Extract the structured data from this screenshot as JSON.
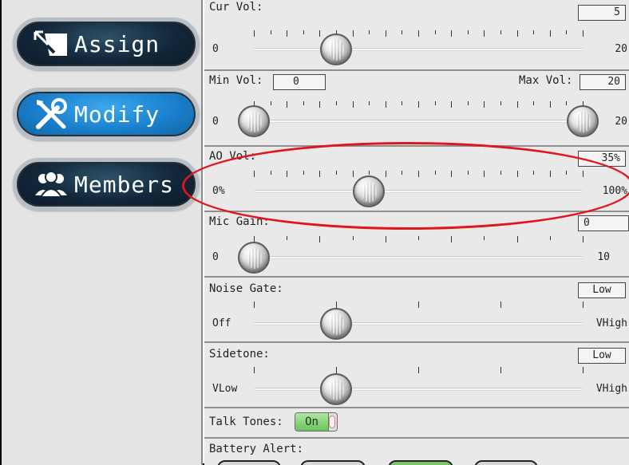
{
  "sidebar": {
    "buttons": [
      {
        "label": "Assign",
        "icon": "assign-arrow-icon",
        "style": "dark"
      },
      {
        "label": "Modify",
        "icon": "wrench-screwdriver-icon",
        "style": "blue"
      },
      {
        "label": "Members",
        "icon": "people-group-icon",
        "style": "dark"
      }
    ]
  },
  "settings": {
    "cur_vol": {
      "label": "Cur Vol:",
      "value": "5",
      "min_label": "0",
      "max_label": "20",
      "min": 0,
      "max": 20,
      "position": 5
    },
    "min_max_vol": {
      "min_label_text": "Min Vol:",
      "min_value": "0",
      "max_label_text": "Max Vol:",
      "max_value": "20",
      "range_min_label": "0",
      "range_max_label": "20",
      "low": 0,
      "high": 20
    },
    "ao_vol": {
      "label": "AO Vol:",
      "value": "35%",
      "min_label": "0%",
      "max_label": "100%",
      "position_percent": 35
    },
    "mic_gain": {
      "label": "Mic Gain:",
      "value": "0",
      "min_label": "0",
      "max_label": "10",
      "position": 0,
      "max": 10
    },
    "noise_gate": {
      "label": "Noise Gate:",
      "value": "Low",
      "min_label": "Off",
      "max_label": "VHigh",
      "level_index": 1,
      "levels": 5
    },
    "sidetone": {
      "label": "Sidetone:",
      "value": "Low",
      "min_label": "VLow",
      "max_label": "VHigh",
      "level_index": 1,
      "levels": 5
    },
    "talk_tones": {
      "label": "Talk Tones:",
      "state": "On"
    },
    "battery_alert": {
      "label": "Battery Alert:"
    }
  },
  "colors": {
    "highlight": "#e0161e",
    "accent_blue": "#1a7fcc",
    "toggle_on": "#6cc25c"
  }
}
